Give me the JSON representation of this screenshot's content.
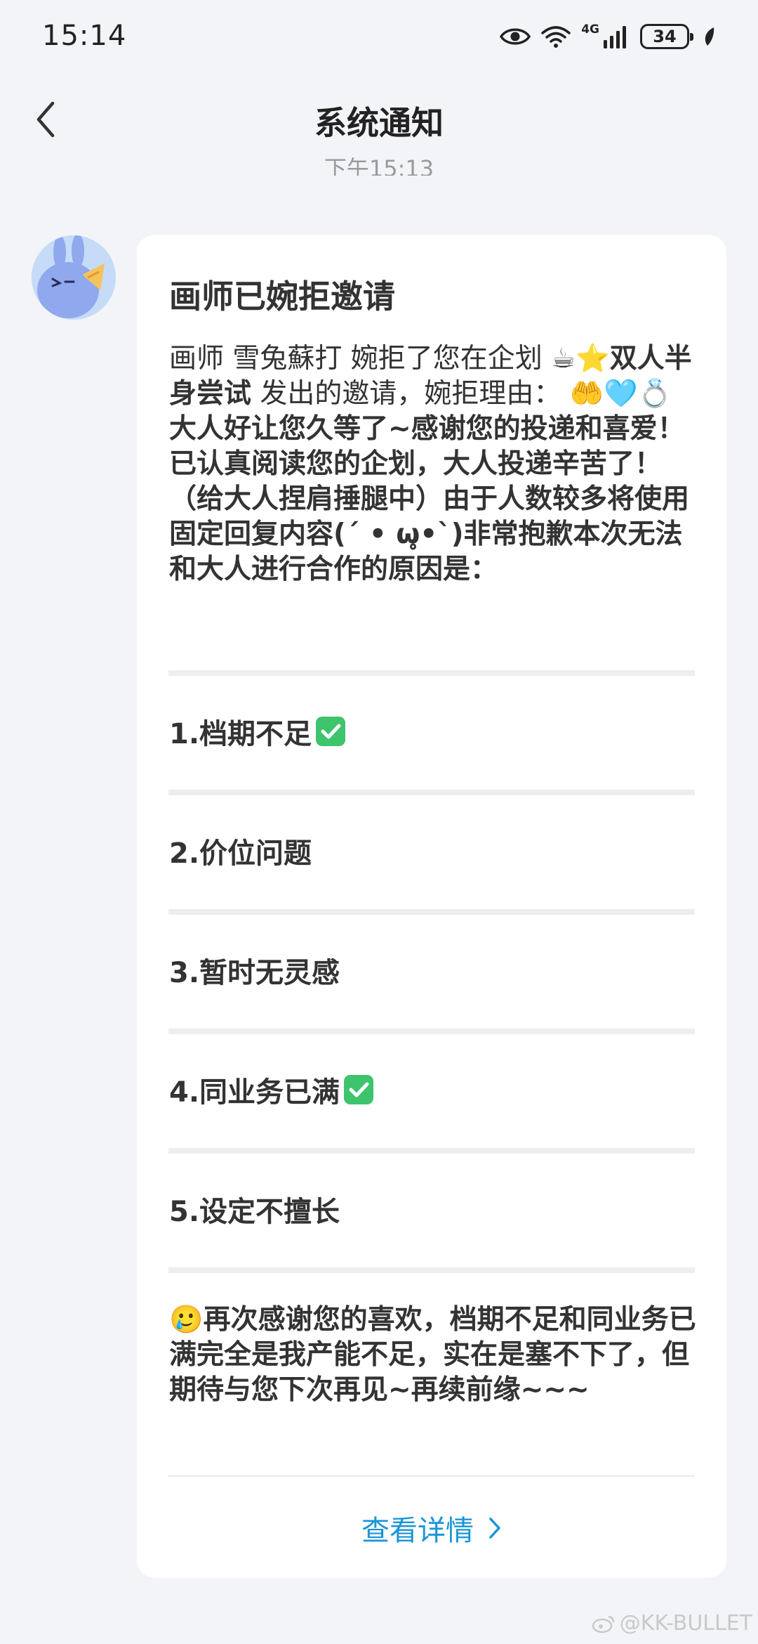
{
  "status_bar": {
    "time": "15:14",
    "network_label": "4G",
    "battery_level": "34",
    "icons": [
      "eye-icon",
      "wifi-icon",
      "signal-icon",
      "battery-icon",
      "leaf-icon"
    ]
  },
  "nav": {
    "title": "系统通知",
    "back_icon": "chevron-left-icon"
  },
  "timestamp": "下午15:13",
  "card": {
    "title": "画师已婉拒邀请",
    "body": {
      "prefix": "画师 雪兔蘇打 婉拒了您在企划 ",
      "emoji_project": "☕⭐",
      "project_name": "双人半身尝试",
      "middle": " 发出的邀请，婉拒理由： ",
      "emoji_reason": "🤲🩵💍",
      "reason": "大人好让您久等了~感谢您的投递和喜爱！已认真阅读您的企划，大人投递辛苦了！（给大人捏肩捶腿中）由于人数较多将使用固定回复内容(´ • ω̥•`)非常抱歉本次无法和大人进行合作的原因是："
    },
    "options": [
      {
        "label": "1.档期不足",
        "checked": true
      },
      {
        "label": "2.价位问题",
        "checked": false
      },
      {
        "label": "3.暂时无灵感",
        "checked": false
      },
      {
        "label": "4.同业务已满",
        "checked": true
      },
      {
        "label": "5.设定不擅长",
        "checked": false
      }
    ],
    "closing_emoji": "🥲",
    "closing": "再次感谢您的喜欢，档期不足和同业务已满完全是我产能不足，实在是塞不下了，但期待与您下次再见~再续前缘~~~",
    "details_link": "查看详情",
    "accent_color": "#1994d8"
  },
  "watermark": "@KK-BULLET"
}
